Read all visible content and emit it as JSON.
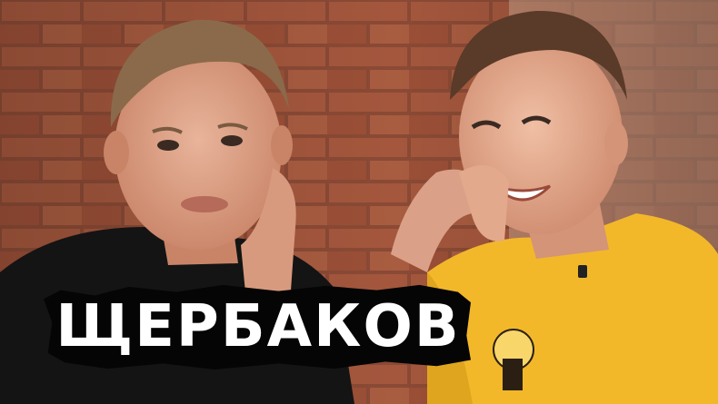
{
  "title": "ЩЕРБАКОВ"
}
